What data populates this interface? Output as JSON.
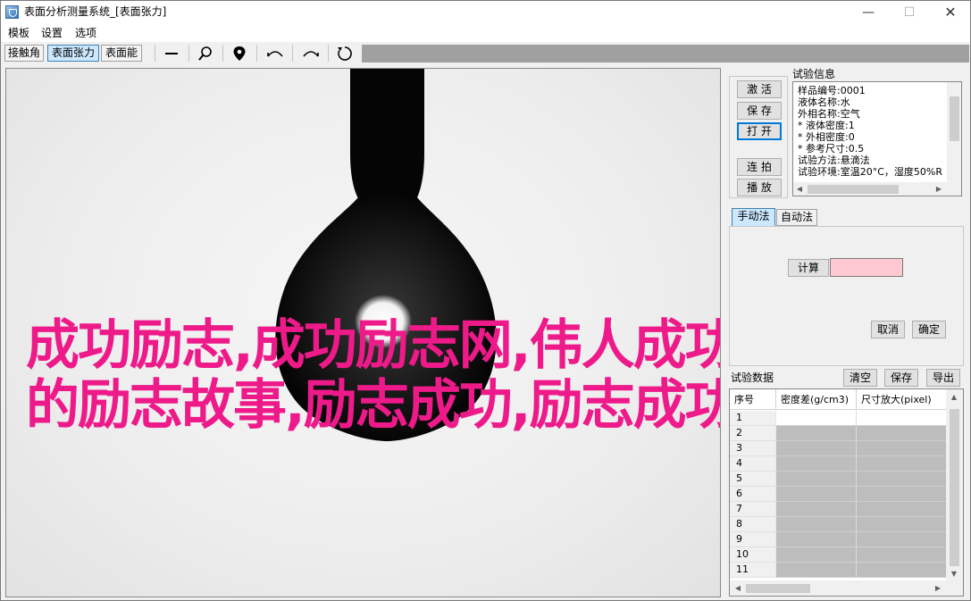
{
  "window": {
    "title": "表面分析测量系统_[表面张力]",
    "controls": {
      "minimize": "—",
      "maximize": "☐",
      "close": "✕"
    }
  },
  "menu": [
    "模板",
    "设置",
    "选项"
  ],
  "toolbar": {
    "tabs": [
      "接触角",
      "表面张力",
      "表面能"
    ],
    "active_tab": "表面张力",
    "tools": [
      "line-icon",
      "magnifier-icon",
      "location-pin-icon",
      "arc-left-icon",
      "arc-right-icon",
      "rotate-icon"
    ]
  },
  "overlay": {
    "line1": "成功励志,成功励志网,伟人成功",
    "line2": "的励志故事,励志成功,励志成功",
    "color": "#ee1a8a"
  },
  "controls": {
    "activate": "激 活",
    "save": "保 存",
    "open": "打 开",
    "continuous_shoot": "连 拍",
    "play": "播 放"
  },
  "experiment_info": {
    "title": "试验信息",
    "lines": [
      "样品编号:0001",
      "液体名称:水",
      "外相名称:空气",
      "* 液体密度:1",
      "* 外相密度:0",
      "* 参考尺寸:0.5",
      "试验方法:悬滴法",
      "试验环境:室温20°C，湿度50%R"
    ]
  },
  "method": {
    "tabs": [
      "手动法",
      "自动法"
    ],
    "active_tab": "手动法",
    "calc_label": "计算",
    "calc_value": "",
    "cancel": "取消",
    "confirm": "确定"
  },
  "experiment_data": {
    "title": "试验数据",
    "clear": "清空",
    "save": "保存",
    "export": "导出",
    "columns": [
      "序号",
      "密度差(g/cm3)",
      "尺寸放大(pixel)"
    ],
    "rows": [
      "1",
      "2",
      "3",
      "4",
      "5",
      "6",
      "7",
      "8",
      "9",
      "10",
      "11"
    ]
  }
}
